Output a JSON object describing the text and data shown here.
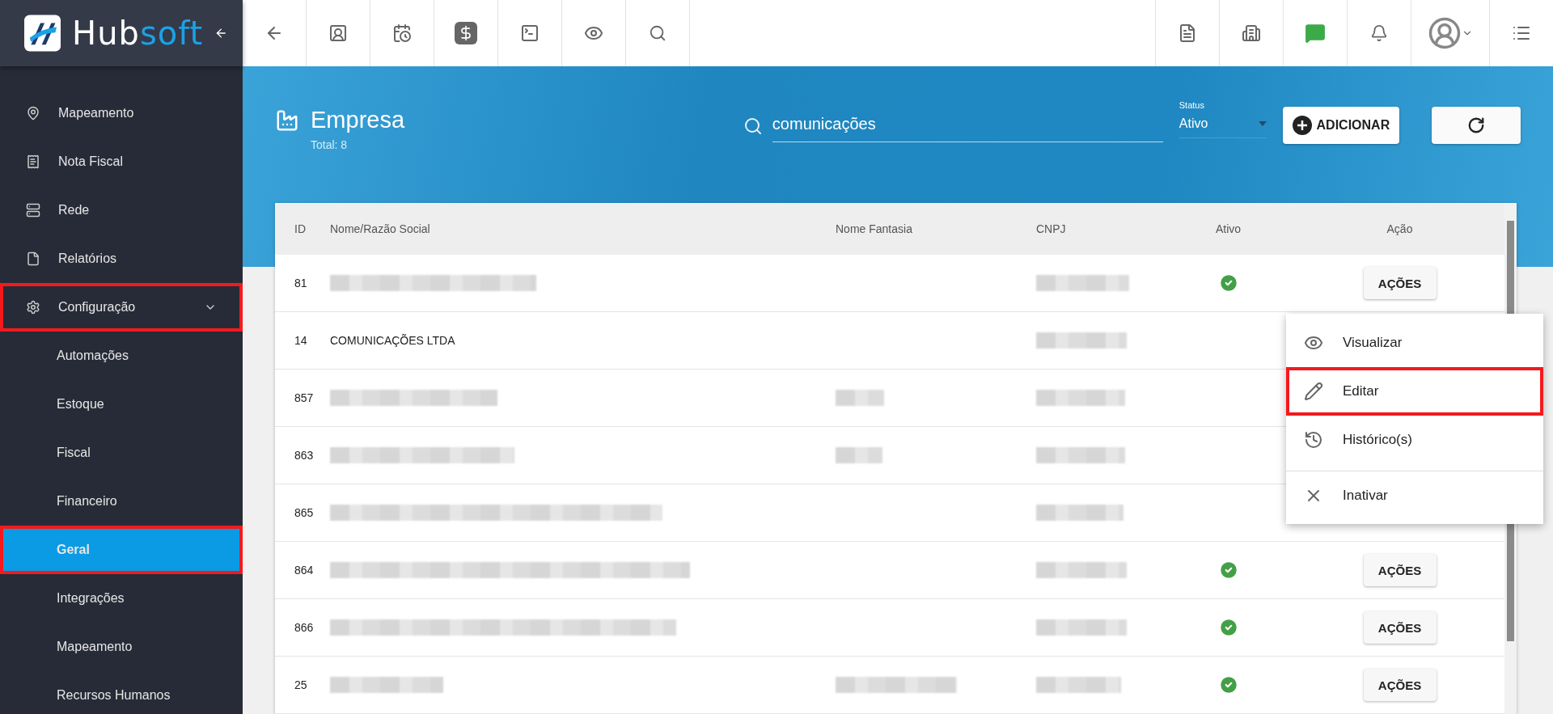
{
  "brand": {
    "name_start": "Hub",
    "name_end": "soft"
  },
  "sidebar": {
    "items": [
      {
        "label": "Mapeamento",
        "selected": false,
        "highlighted": false
      },
      {
        "label": "Nota Fiscal",
        "selected": false,
        "highlighted": false
      },
      {
        "label": "Rede",
        "selected": false,
        "highlighted": false
      },
      {
        "label": "Relatórios",
        "selected": false,
        "highlighted": false
      },
      {
        "label": "Configuração",
        "expanded": true,
        "selected": false,
        "highlighted": true,
        "children": [
          {
            "label": "Automações",
            "selected": false,
            "highlighted": false
          },
          {
            "label": "Estoque",
            "selected": false,
            "highlighted": false
          },
          {
            "label": "Fiscal",
            "selected": false,
            "highlighted": false
          },
          {
            "label": "Financeiro",
            "selected": false,
            "highlighted": false
          },
          {
            "label": "Geral",
            "selected": true,
            "highlighted": true
          },
          {
            "label": "Integrações",
            "selected": false,
            "highlighted": false
          },
          {
            "label": "Mapeamento",
            "selected": false,
            "highlighted": false
          },
          {
            "label": "Recursos Humanos",
            "selected": false,
            "highlighted": false
          }
        ]
      }
    ]
  },
  "page": {
    "title": "Empresa",
    "total": "Total: 8",
    "search": {
      "value": "comunicações"
    },
    "status": {
      "label": "Status",
      "value": "Ativo"
    },
    "add_button": "ADICIONAR"
  },
  "table": {
    "columns": [
      "ID",
      "Nome/Razão Social",
      "Nome Fantasia",
      "CNPJ",
      "Ativo",
      "Ação"
    ],
    "rows": [
      {
        "id": "81",
        "name_blurred": true,
        "cnpj_blurred": true,
        "active": true,
        "action": "AÇÕES"
      },
      {
        "id": "14",
        "name": "COMUNICAÇÕES LTDA",
        "cnpj_blurred": true
      },
      {
        "id": "857",
        "name_blurred": true,
        "fantasy_blurred": true,
        "cnpj_blurred": true
      },
      {
        "id": "863",
        "name_blurred": true,
        "fantasy_blurred": true,
        "cnpj_blurred": true
      },
      {
        "id": "865",
        "name_blurred": true,
        "cnpj_blurred": true
      },
      {
        "id": "864",
        "name_blurred": true,
        "cnpj_blurred": true,
        "active": true,
        "action": "AÇÕES"
      },
      {
        "id": "866",
        "name_blurred": true,
        "cnpj_blurred": true,
        "active": true,
        "action": "AÇÕES"
      },
      {
        "id": "25",
        "name_blurred": true,
        "fantasy_blurred": true,
        "cnpj_blurred": true,
        "active": true,
        "action": "AÇÕES"
      }
    ]
  },
  "action_menu": {
    "items": [
      {
        "label": "Visualizar",
        "kind": "view",
        "highlighted": false
      },
      {
        "label": "Editar",
        "kind": "edit",
        "highlighted": true
      },
      {
        "label": "Histórico(s)",
        "kind": "history",
        "highlighted": false
      },
      {
        "label": "Inativar",
        "kind": "deactivate",
        "highlighted": false
      }
    ]
  }
}
